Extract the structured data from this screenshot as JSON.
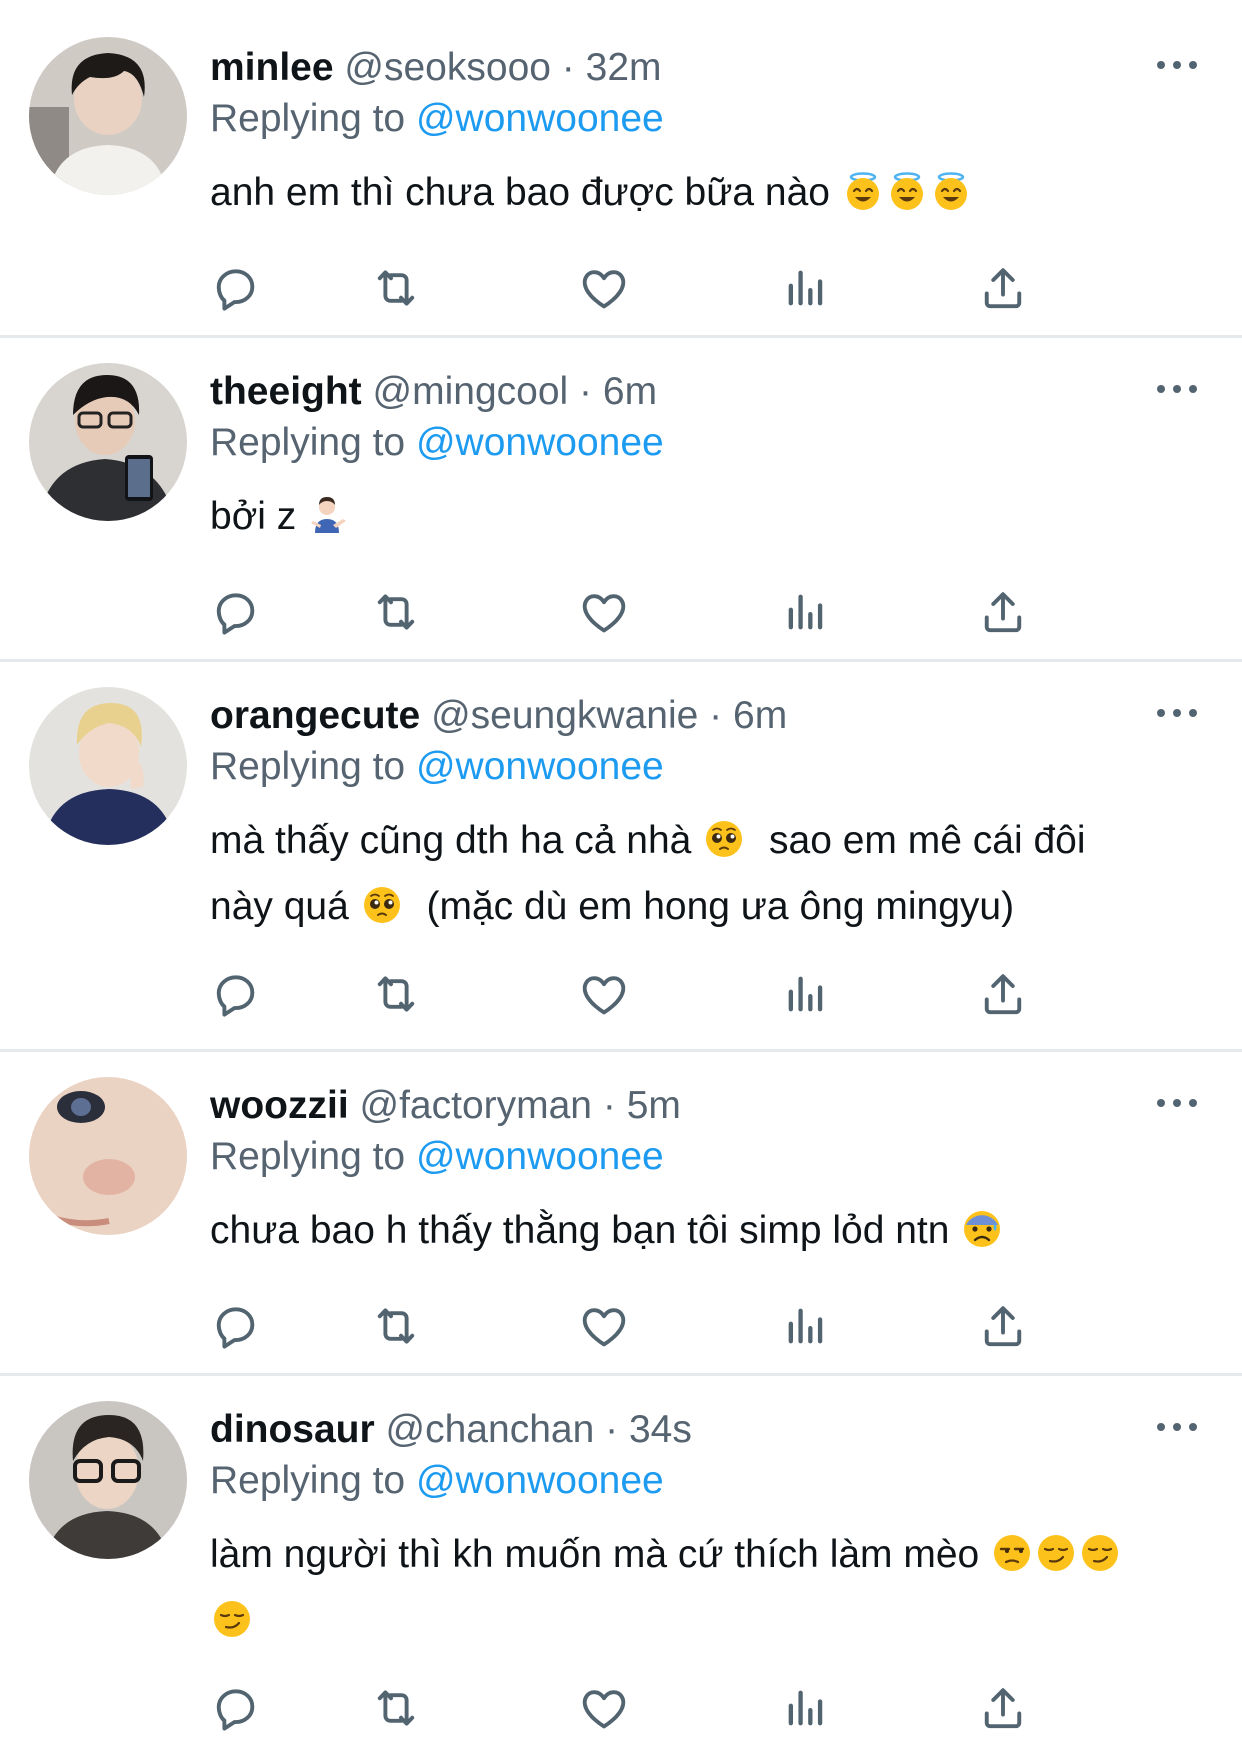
{
  "tweets": [
    {
      "name": "minlee",
      "handle": "@seoksooo",
      "separator": "·",
      "time": "32m",
      "replying_prefix": "Replying to",
      "replying_to": "@wonwoonee",
      "text": "anh em thì chưa bao được bữa nào",
      "emojis": [
        "smiling-halo-emoji",
        "smiling-halo-emoji",
        "smiling-halo-emoji"
      ]
    },
    {
      "name": "theeight",
      "handle": "@mingcool",
      "separator": "·",
      "time": "6m",
      "replying_prefix": "Replying to",
      "replying_to": "@wonwoonee",
      "text": "bởi z",
      "emojis": [
        "person-shrugging-emoji"
      ]
    },
    {
      "name": "orangecute",
      "handle": "@seungkwanie",
      "separator": "·",
      "time": "6m",
      "replying_prefix": "Replying to",
      "replying_to": "@wonwoonee",
      "text_line1_a": "mà thấy cũng dth ha cả nhà",
      "text_line1_b": "sao em mê cái đôi",
      "text_line2_a": "này quá",
      "text_line2_b": "(mặc dù em hong ưa ông mingyu)",
      "emojis": [
        "pleading-face-emoji",
        "pleading-face-emoji"
      ]
    },
    {
      "name": "woozzii",
      "handle": "@factoryman",
      "separator": "·",
      "time": "5m",
      "replying_prefix": "Replying to",
      "replying_to": "@wonwoonee",
      "text": "chưa bao h thấy thằng bạn tôi simp lỏd ntn",
      "emojis": [
        "anxious-sweat-face-emoji"
      ]
    },
    {
      "name": "dinosaur",
      "handle": "@chanchan",
      "separator": "·",
      "time": "34s",
      "replying_prefix": "Replying to",
      "replying_to": "@wonwoonee",
      "text": "làm người thì kh muốn mà cứ thích làm mèo",
      "emojis": [
        "unamused-face-emoji",
        "smirking-face-emoji",
        "smirking-face-emoji",
        "smirking-face-emoji"
      ]
    }
  ],
  "icons": {
    "reply": "reply-icon",
    "retweet": "retweet-icon",
    "like": "heart-icon",
    "views": "views-icon",
    "share": "share-icon",
    "more": "more-options-icon"
  },
  "colors": {
    "text": "#0f1419",
    "secondary": "#566370",
    "link": "#1d9bf0",
    "divider": "#e6e9eb",
    "icon": "#536471"
  }
}
